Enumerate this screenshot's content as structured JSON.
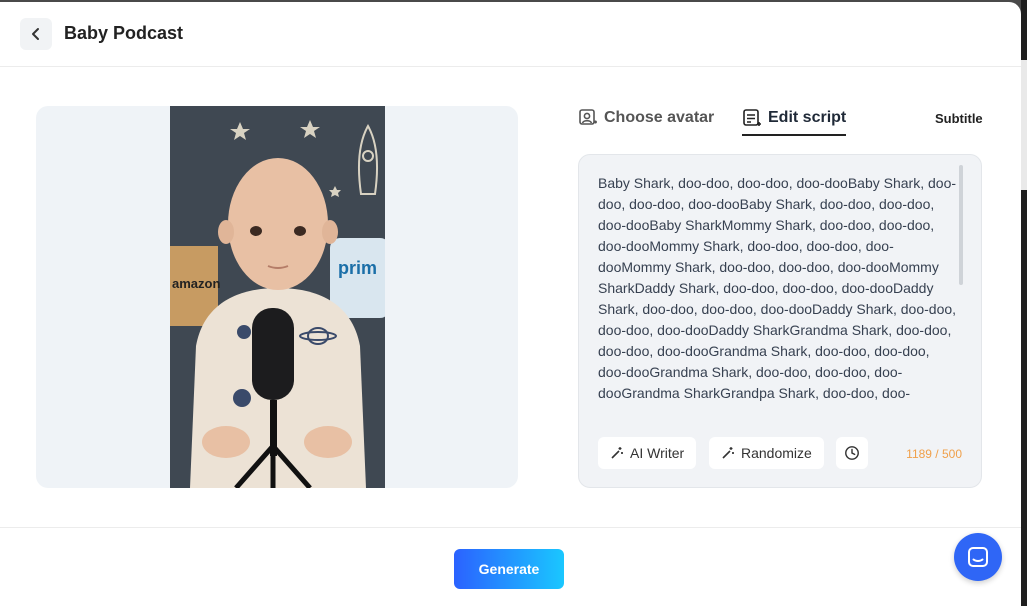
{
  "header": {
    "title": "Baby Podcast"
  },
  "tabs": [
    {
      "label": "Choose avatar",
      "icon": "avatar-icon"
    },
    {
      "label": "Edit script",
      "icon": "script-icon",
      "active": true
    },
    {
      "label": "Subtitle"
    }
  ],
  "preview": {
    "image_text": [
      "amazon",
      "prim"
    ]
  },
  "script": {
    "text": "Baby Shark, doo-doo, doo-doo, doo-dooBaby Shark, doo-doo, doo-doo, doo-dooBaby Shark, doo-doo, doo-doo, doo-dooBaby SharkMommy Shark, doo-doo, doo-doo, doo-dooMommy Shark, doo-doo, doo-doo, doo-dooMommy Shark, doo-doo, doo-doo, doo-dooMommy SharkDaddy Shark, doo-doo, doo-doo, doo-dooDaddy Shark, doo-doo, doo-doo, doo-dooDaddy Shark, doo-doo, doo-doo, doo-dooDaddy SharkGrandma Shark, doo-doo, doo-doo, doo-dooGrandma Shark, doo-doo, doo-doo, doo-dooGrandma Shark, doo-doo, doo-doo, doo-dooGrandma SharkGrandpa Shark, doo-doo, doo-",
    "ai_writer_label": "AI Writer",
    "randomize_label": "Randomize",
    "char_count": "1189 / 500"
  },
  "footer": {
    "generate_label": "Generate"
  },
  "colors": {
    "accent": "#2f66f6",
    "counter_warning": "#f0a04b"
  }
}
